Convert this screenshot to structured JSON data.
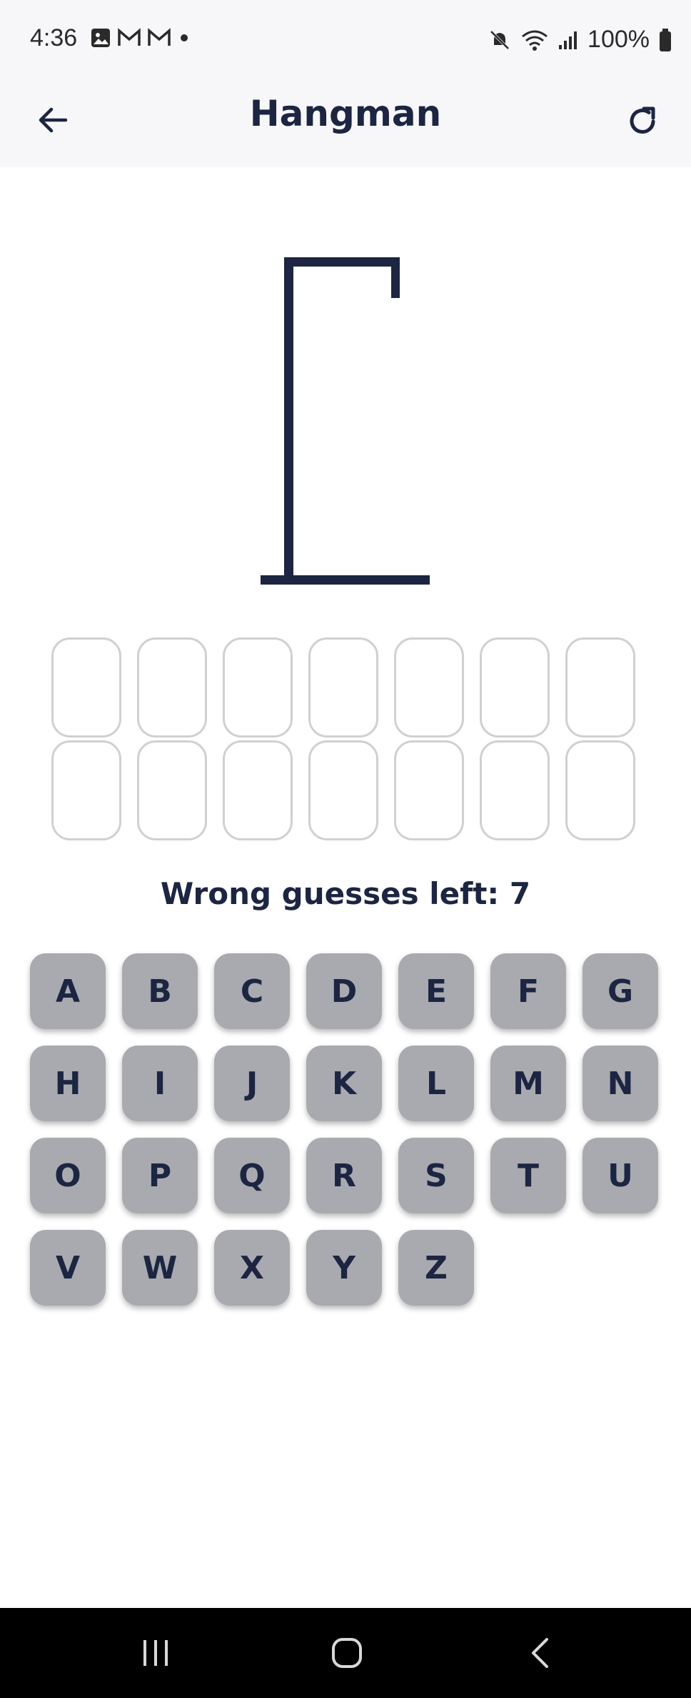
{
  "status_bar": {
    "time": "4:36",
    "left_icons": [
      "image-icon",
      "gmail-icon",
      "gmail-icon",
      "dot-icon"
    ],
    "right_icons": [
      "mute-icon",
      "wifi-icon",
      "signal-icon",
      "battery-icon"
    ],
    "battery": "100%"
  },
  "app_bar": {
    "title": "Hangman",
    "back_icon": "arrow-left-icon",
    "refresh_icon": "refresh-icon"
  },
  "game": {
    "word_slots": [
      "",
      "",
      "",
      "",
      "",
      "",
      "",
      "",
      "",
      "",
      "",
      "",
      "",
      ""
    ],
    "wrong_guesses_label": "Wrong guesses left: 7"
  },
  "keyboard": {
    "keys": [
      "A",
      "B",
      "C",
      "D",
      "E",
      "F",
      "G",
      "H",
      "I",
      "J",
      "K",
      "L",
      "M",
      "N",
      "O",
      "P",
      "Q",
      "R",
      "S",
      "T",
      "U",
      "V",
      "W",
      "X",
      "Y",
      "Z"
    ]
  },
  "nav_bar": {
    "buttons": [
      "recents-icon",
      "home-icon",
      "back-icon"
    ]
  },
  "colors": {
    "primary": "#1c2541",
    "key_bg": "#a9aab0",
    "slot_border": "#d0d0d0",
    "appbar_bg": "#f7f7fa"
  }
}
